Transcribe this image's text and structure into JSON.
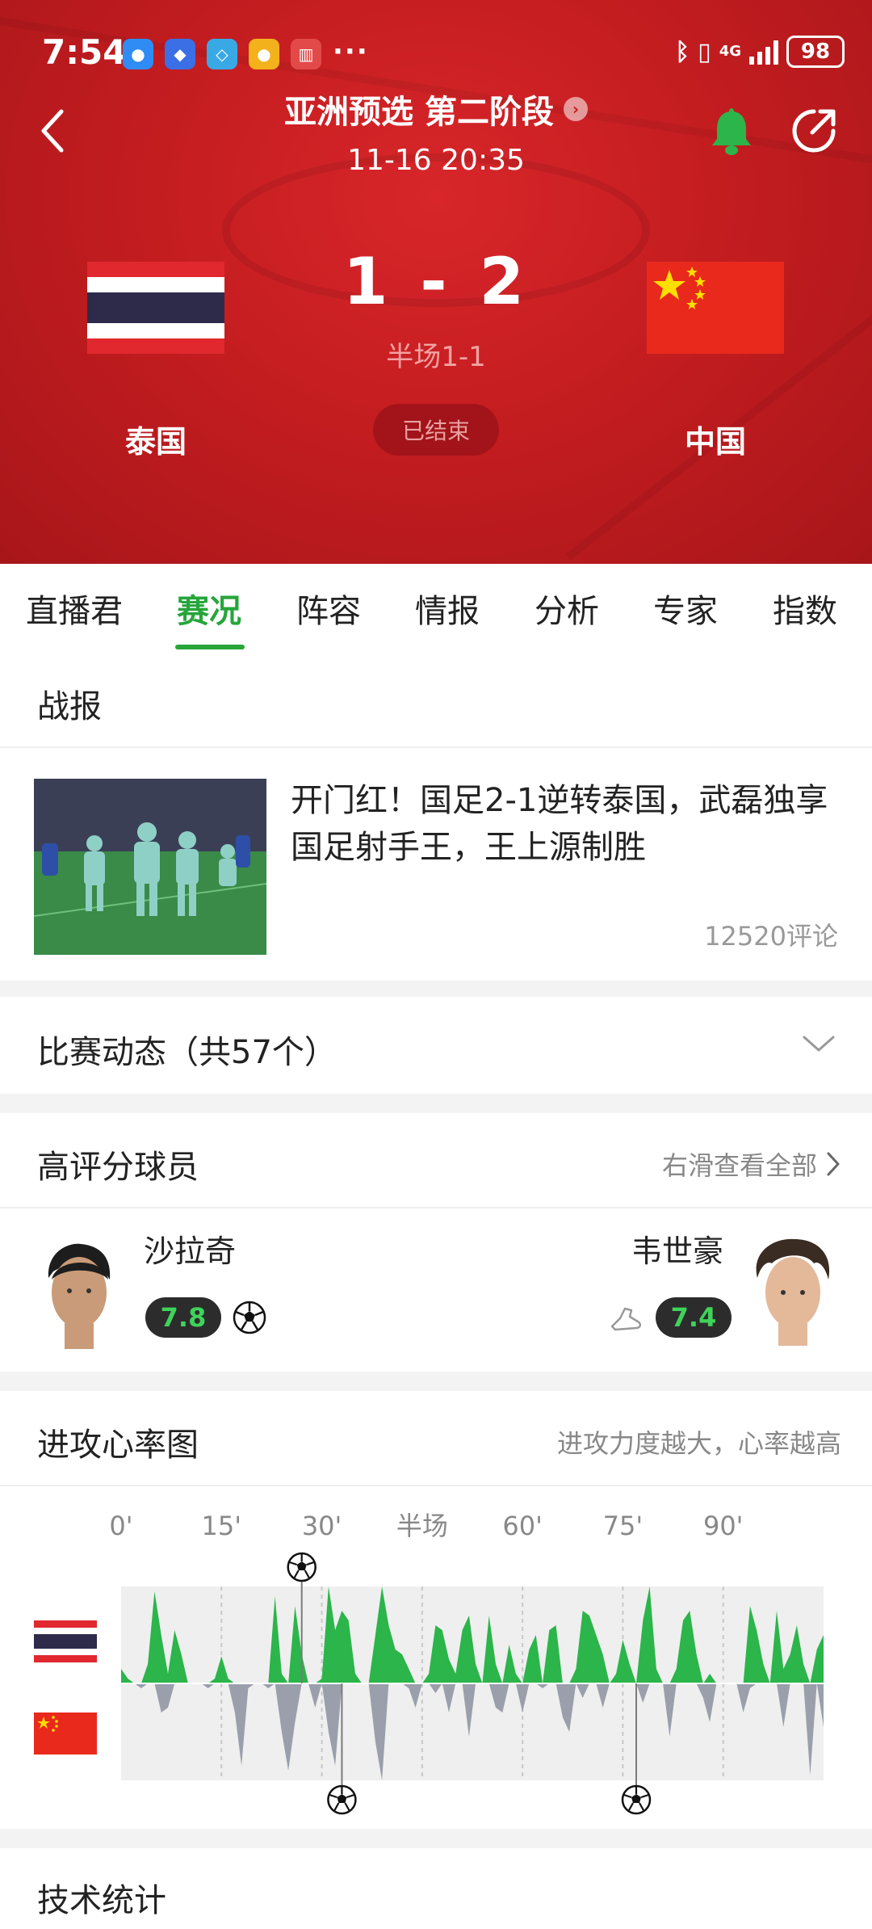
{
  "status_bar": {
    "time": "7:54",
    "more": "···",
    "network": "4G",
    "battery": "98"
  },
  "header": {
    "league": "亚洲预选 第二阶段",
    "datetime": "11-16 20:35"
  },
  "match": {
    "home_team": "泰国",
    "away_team": "中国",
    "score": "1 - 2",
    "halftime": "半场1-1",
    "status": "已结束"
  },
  "tabs": [
    "直播君",
    "赛况",
    "阵容",
    "情报",
    "分析",
    "专家",
    "指数"
  ],
  "active_tab": 1,
  "report": {
    "section_title": "战报",
    "headline": "开门红！国足2-1逆转泰国，武磊独享国足射手王，王上源制胜",
    "comments": "12520评论"
  },
  "events": {
    "title": "比赛动态（共57个）"
  },
  "top_players": {
    "title": "高评分球员",
    "more": "右滑查看全部",
    "home": {
      "name": "沙拉奇",
      "rating": "7.8"
    },
    "away": {
      "name": "韦世豪",
      "rating": "7.4"
    }
  },
  "heart_rate": {
    "title": "进攻心率图",
    "note": "进攻力度越大，心率越高",
    "ticks": [
      "0'",
      "15'",
      "30'",
      "半场",
      "60'",
      "75'",
      "90'"
    ]
  },
  "chart_data": {
    "type": "area",
    "title": "",
    "x_ticks": [
      "0'",
      "15'",
      "30'",
      "半场",
      "60'",
      "75'",
      "90'"
    ],
    "series": [
      {
        "name": "",
        "values": [
          0.15,
          0.05,
          0,
          0,
          0.2,
          0.95,
          0.5,
          0.1,
          0.55,
          0.3,
          0,
          0,
          0,
          0,
          0.05,
          0.28,
          0.05,
          0,
          0,
          0,
          0,
          0,
          0,
          0.9,
          0.1,
          0,
          0.8,
          0.3,
          0,
          0,
          0.05,
          1,
          0.55,
          0.75,
          0.65,
          0.1,
          0,
          0,
          0.5,
          1,
          0.6,
          0.35,
          0.3,
          0.15,
          0,
          0,
          0.1,
          0.6,
          0.55,
          0.25,
          0.1,
          0.55,
          0.7,
          0.2,
          0,
          0.7,
          0.2,
          0,
          0.4,
          0.1,
          0,
          0.35,
          0.5,
          0,
          0.55,
          0.6,
          0,
          0,
          0.15,
          0.75,
          0.7,
          0.5,
          0.3,
          0,
          0.1,
          0.45,
          0.2,
          0,
          0.65,
          1,
          0.15,
          0,
          0,
          0.15,
          0.65,
          0.75,
          0.3,
          0,
          0.1,
          0,
          0,
          0,
          0,
          0,
          0.8,
          0.55,
          0.2,
          0,
          0.75,
          0.15,
          0.3,
          0.6,
          0.2,
          0,
          0.35,
          0.5
        ]
      },
      {
        "name": "",
        "values": [
          0,
          0,
          0,
          0.05,
          0,
          0,
          0.3,
          0.25,
          0,
          0,
          0,
          0,
          0,
          0.05,
          0,
          0,
          0,
          0.3,
          0.85,
          0.05,
          0,
          0,
          0.05,
          0,
          0.5,
          0.9,
          0.4,
          0,
          0,
          0.25,
          0,
          0.5,
          0.85,
          0,
          0,
          0,
          0,
          0,
          0.6,
          1,
          0,
          0,
          0,
          0.05,
          0.25,
          0,
          0,
          0.1,
          0,
          0.3,
          0,
          0,
          0.55,
          0,
          0,
          0,
          0.25,
          0.3,
          0,
          0,
          0.3,
          0,
          0,
          0.05,
          0,
          0,
          0.35,
          0.5,
          0,
          0.15,
          0,
          0,
          0.25,
          0,
          0,
          0,
          0,
          0,
          0.2,
          0,
          0,
          0,
          0.55,
          0,
          0,
          0,
          0,
          0.15,
          0.4,
          0,
          0,
          0,
          0,
          0.3,
          0.05,
          0,
          0,
          0,
          0,
          0.45,
          0,
          0,
          0,
          0.95,
          0,
          0.45
        ]
      }
    ],
    "goals": [
      {
        "team": "home",
        "minute": 27
      },
      {
        "team": "away",
        "minute": 33
      },
      {
        "team": "away",
        "minute": 77
      }
    ]
  },
  "stats": {
    "title": "技术统计"
  }
}
